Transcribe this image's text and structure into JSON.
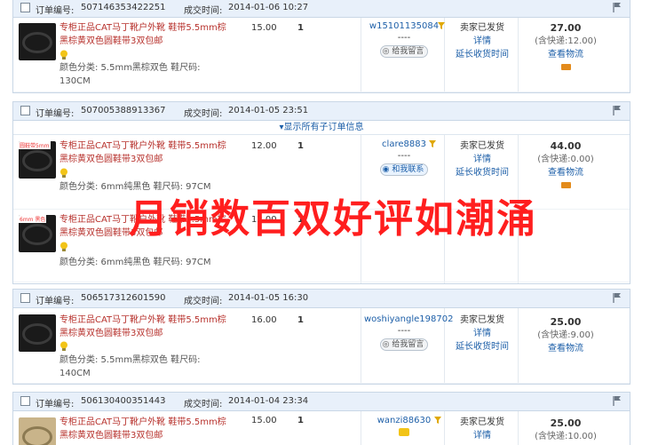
{
  "labels": {
    "order_no": "订单编号:",
    "deal_time": "成交时间:",
    "show_sub_orders": "▾显示所有子订单信息",
    "details": "详情",
    "extend_receipt": "延长收货时间",
    "view_logistics": "查看物流",
    "msg_button": "给我留言",
    "contact_button": "和我联系",
    "dash": "----"
  },
  "overlay_text": "月销数百双好评如潮涌",
  "orders": [
    {
      "order_no": "507146353422251",
      "time": "2014-01-06 10:27",
      "items": [
        {
          "thumb_tag": "",
          "title": "专柜正品CAT马丁靴户外靴 鞋带5.5mm棕黑棕黄双色圆鞋带3双包邮",
          "attr": "颜色分类: 5.5mm黑棕双色    鞋尺码: 130CM",
          "price": "15.00",
          "qty": "1"
        }
      ],
      "buyer": "w15101135084",
      "button": "给我留言",
      "status": "卖家已发货",
      "total": "27.00",
      "ship": "(含快递:12.00)"
    },
    {
      "order_no": "507005388913367",
      "time": "2014-01-05 23:51",
      "items": [
        {
          "thumb_tag": "圆鞋带5mm",
          "title": "专柜正品CAT马丁靴户外靴 鞋带5.5mm棕黑棕黄双色圆鞋带3双包邮",
          "attr": "颜色分类: 6mm纯黑色    鞋尺码: 97CM",
          "price": "12.00",
          "qty": "1"
        },
        {
          "thumb_tag": "6mm 黑色",
          "title": "专柜正品CAT马丁靴户外靴 鞋带5.5mm棕黑棕黄双色圆鞋带3双包邮",
          "attr": "颜色分类: 6mm纯黑色    鞋尺码: 97CM",
          "price": "12.00",
          "qty": "1"
        }
      ],
      "buyer": "clare8883",
      "button": "和我联系",
      "status": "卖家已发货",
      "total": "44.00",
      "ship": "(含快递:0.00)"
    },
    {
      "order_no": "506517312601590",
      "time": "2014-01-05 16:30",
      "items": [
        {
          "thumb_tag": "",
          "title": "专柜正品CAT马丁靴户外靴 鞋带5.5mm棕黑棕黄双色圆鞋带3双包邮",
          "attr": "颜色分类: 5.5mm黑棕双色    鞋尺码: 140CM",
          "price": "16.00",
          "qty": "1"
        }
      ],
      "buyer": "woshiyangle198702",
      "button": "给我留言",
      "status": "卖家已发货",
      "total": "25.00",
      "ship": "(含快递:9.00)"
    },
    {
      "order_no": "506130400351443",
      "time": "2014-01-04 23:34",
      "items": [
        {
          "thumb_tag": "",
          "title": "专柜正品CAT马丁靴户外靴 鞋带5.5mm棕黑棕黄双色圆鞋带3双包邮",
          "attr": "",
          "price": "15.00",
          "qty": "1"
        }
      ],
      "buyer": "wanzi88630",
      "button": "",
      "status": "卖家已发货",
      "total": "25.00",
      "ship": "(含快递:10.00)"
    }
  ],
  "colors": {
    "header_bg": "#e8f0fa",
    "title_red": "#b7312c",
    "link_blue": "#1d5fa8",
    "overlay_red": "#ff1e1e"
  }
}
